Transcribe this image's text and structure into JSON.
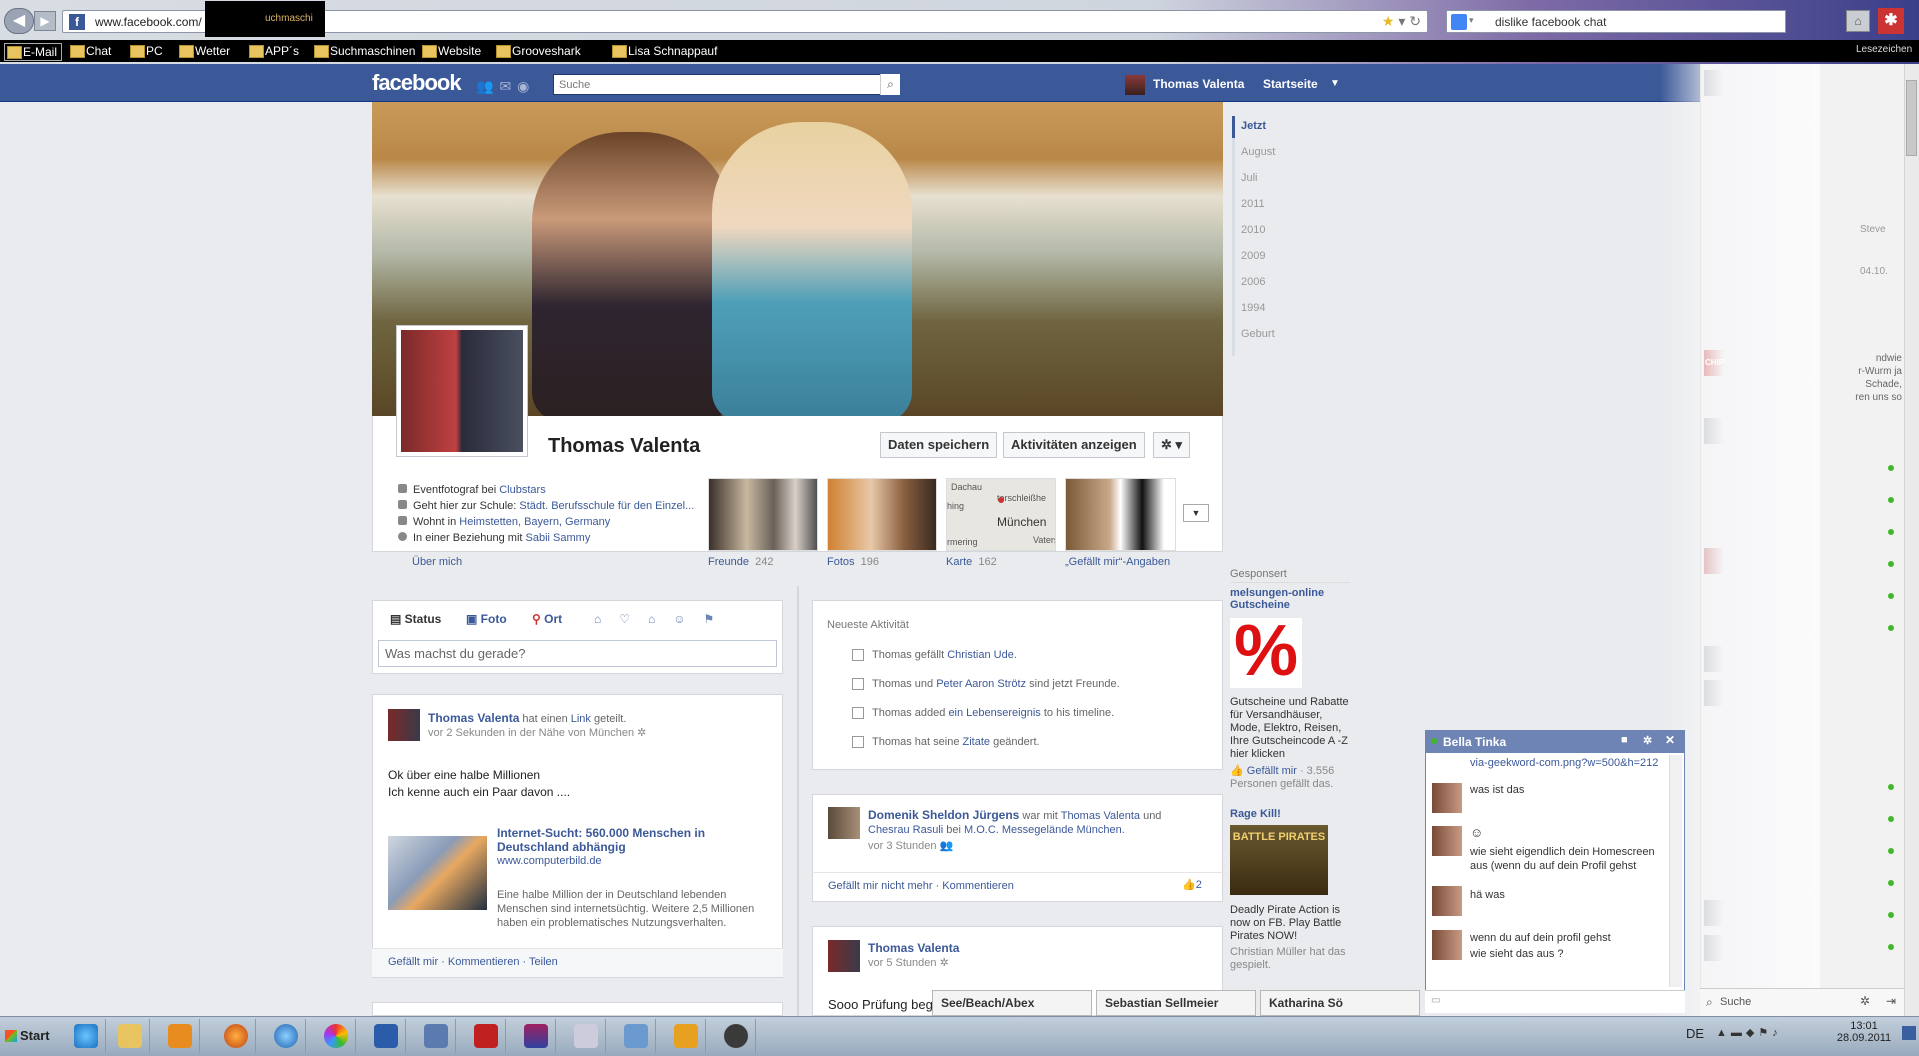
{
  "browser": {
    "url": "www.facebook.com/",
    "url_overlay": "uchmaschi",
    "search_value": "dislike facebook chat",
    "bookmarks_end": "Lesezeichen",
    "bookmarks": [
      "E-Mail",
      "Chat",
      "PC",
      "Wetter",
      "APP´s",
      "Suchmaschinen",
      "Website",
      "Grooveshark",
      "Lisa Schnappauf"
    ]
  },
  "fb": {
    "logo": "facebook",
    "search_placeholder": "Suche",
    "user_name": "Thomas Valenta",
    "home": "Startseite"
  },
  "profile": {
    "name": "Thomas Valenta",
    "buttons": {
      "save": "Daten speichern",
      "activity": "Aktivitäten anzeigen"
    },
    "info": [
      {
        "prefix": "Eventfotograf bei ",
        "link": "Clubstars"
      },
      {
        "prefix": "Geht hier zur Schule: ",
        "link": "Städt. Berufsschule für den Einzel..."
      },
      {
        "prefix": "Wohnt in ",
        "link": "Heimstetten, Bayern, Germany"
      },
      {
        "prefix": "In einer Beziehung mit ",
        "link": "Sabii Sammy"
      }
    ],
    "about": "Über mich",
    "thumbs": [
      {
        "label": "Freunde",
        "count": "242"
      },
      {
        "label": "Fotos",
        "count": "196"
      },
      {
        "label": "Karte",
        "count": "162"
      },
      {
        "label": "„Gefällt mir“-Angaben",
        "count": ""
      }
    ],
    "map_labels": [
      "Dachau",
      "München",
      "hing",
      "rmering",
      "Vaters",
      "terschleißhe"
    ]
  },
  "timeline_nav": [
    "Jetzt",
    "August",
    "Juli",
    "2011",
    "2010",
    "2009",
    "2006",
    "1994",
    "Geburt"
  ],
  "composer": {
    "tabs": [
      "Status",
      "Foto",
      "Ort"
    ],
    "placeholder": "Was machst du gerade?"
  },
  "post1": {
    "name": "Thomas Valenta",
    "action": " hat einen ",
    "action_link": "Link",
    "action_end": " geteilt.",
    "meta": "vor 2 Sekunden in der Nähe von München",
    "text1": "Ok über eine halbe Millionen",
    "text2": "Ich kenne auch ein Paar davon ....",
    "link_title": "Internet-Sucht: 560.000 Menschen in Deutschland abhängig",
    "link_domain": "www.computerbild.de",
    "link_desc": "Eine halbe Million der in Deutschland lebenden Menschen sind internetsüchtig. Weitere 2,5 Millionen haben ein problematisches Nutzungsverhalten.",
    "actions": [
      "Gefällt mir",
      "Kommentieren",
      "Teilen"
    ]
  },
  "activity": {
    "title": "Neueste Aktivität",
    "rows": [
      {
        "pre": "Thomas gefällt ",
        "link": "Christian Ude",
        "post": "."
      },
      {
        "pre": "Thomas und ",
        "link": "Peter Aaron Strötz",
        "post": " sind jetzt Freunde."
      },
      {
        "pre": "Thomas added ",
        "link": "ein Lebensereignis",
        "post": " to his timeline."
      },
      {
        "pre": "Thomas hat seine ",
        "link": "Zitate",
        "post": " geändert."
      }
    ]
  },
  "post2": {
    "name": "Domenik Sheldon Jürgens",
    "mid": " war mit ",
    "with1": "Thomas Valenta",
    "and": " und",
    "with2": "Chesrau Rasuli",
    "at": " bei ",
    "place": "M.O.C. Messegelände München",
    "end": ".",
    "meta": "vor 3 Stunden",
    "actions": "Gefällt mir nicht mehr · Kommentieren",
    "likes": "2"
  },
  "post3": {
    "name": "Thomas Valenta",
    "meta": "vor 5 Stunden",
    "text": "Sooo Prüfung begi"
  },
  "sponsored": {
    "label": "Gesponsert",
    "ad1_title": "melsungen-online Gutscheine",
    "ad1_text": "Gutscheine und Rabatte für Versandhäuser, Mode, Elektro, Reisen, Ihre Gutscheincode A -Z hier klicken",
    "ad1_like": "Gefällt mir",
    "ad1_count": " · 3.556 Personen gefällt das.",
    "ad2_title": "Rage Kill!",
    "ad2_img": "BATTLE PIRATES",
    "ad2_text": "Deadly Pirate Action is now on FB. Play Battle Pirates NOW!",
    "ad2_social": "Christian Müller hat das gespielt."
  },
  "chat": {
    "name": "Bella Tinka",
    "link": "via-geekword-com.png?w=500&h=212",
    "messages": [
      "was ist das",
      "wie sieht eigendlich dein Homescreen",
      "aus (wenn du auf dein Profil gehst",
      "hä was",
      "wenn du auf dein profil gehst",
      "wie sieht das aus ?"
    ],
    "tabs": [
      "See/Beach/Abex",
      "Sebastian Sellmeier",
      "Katharina Sö"
    ],
    "search": "Suche",
    "sidebar_texts": [
      "Steve",
      "04.10.",
      "CHIP",
      "ndwie",
      "r-Wurm ja",
      "Schade,",
      "ren uns so"
    ]
  },
  "taskbar": {
    "start": "Start",
    "lang": "DE",
    "time": "13:01",
    "date": "28.09.2011"
  },
  "colors": {
    "fb_blue": "#3b5998",
    "online": "#42b72a"
  }
}
